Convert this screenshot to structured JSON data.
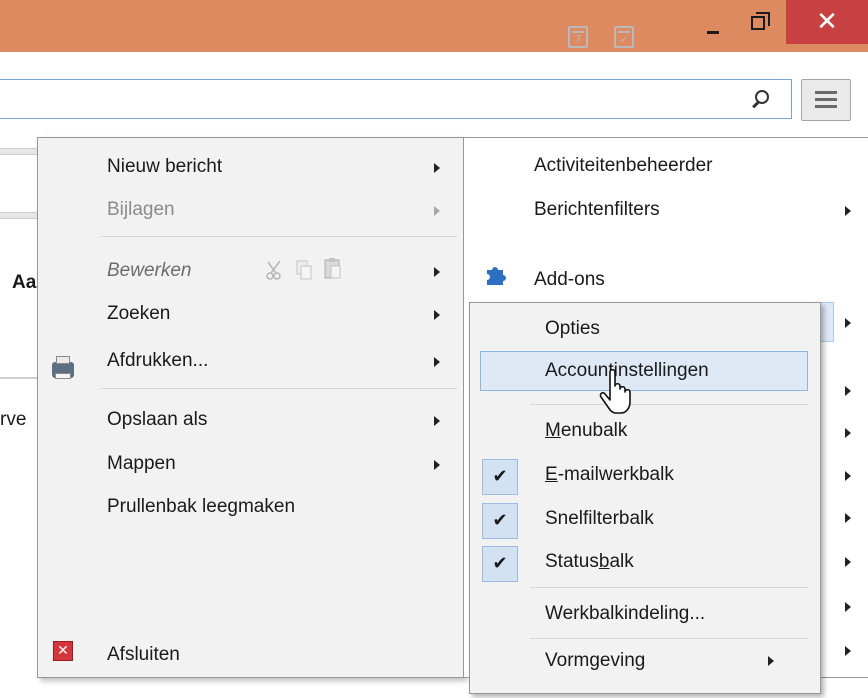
{
  "window": {
    "calendar_day": "7",
    "close_symbol": "✕"
  },
  "background_fragments": {
    "column_header": "Aa",
    "row_text": "rve"
  },
  "main_menu": {
    "items": [
      {
        "label": "Nieuw bericht",
        "has_submenu": true,
        "disabled": false
      },
      {
        "label": "Bijlagen",
        "has_submenu": true,
        "disabled": true
      },
      {
        "label": "Bewerken",
        "has_submenu": true,
        "disabled": false,
        "style": "italic"
      },
      {
        "label": "Zoeken",
        "has_submenu": true,
        "disabled": false
      },
      {
        "label": "Afdrukken...",
        "has_submenu": true,
        "disabled": false
      },
      {
        "label": "Opslaan als",
        "has_submenu": true,
        "disabled": false
      },
      {
        "label": "Mappen",
        "has_submenu": true,
        "disabled": false
      },
      {
        "label": "Prullenbak leegmaken",
        "has_submenu": false,
        "disabled": false
      },
      {
        "label": "Afsluiten",
        "has_submenu": false,
        "disabled": false
      }
    ],
    "right_items": [
      {
        "label": "Activiteitenbeheerder",
        "has_submenu": false
      },
      {
        "label": "Berichtenfilters",
        "has_submenu": true
      },
      {
        "label": "Add-ons",
        "has_submenu": false
      }
    ]
  },
  "submenu": {
    "items": [
      {
        "label_pre": "Opties",
        "label_u": "",
        "label_post": "",
        "checked": false
      },
      {
        "label_pre": "Accountinstellingen",
        "label_u": "",
        "label_post": "",
        "checked": false,
        "highlighted": true
      },
      {
        "label_pre": "",
        "label_u": "M",
        "label_post": "enubalk",
        "checked": false
      },
      {
        "label_pre": "",
        "label_u": "E",
        "label_post": "-mailwerkbalk",
        "checked": true
      },
      {
        "label_pre": "Snelfilterbalk",
        "label_u": "",
        "label_post": "",
        "checked": true
      },
      {
        "label_pre": "Status",
        "label_u": "b",
        "label_post": "alk",
        "checked": true
      },
      {
        "label_pre": "Werkbalkindeling...",
        "label_u": "",
        "label_post": "",
        "checked": false
      },
      {
        "label_pre": "Vormgeving",
        "label_u": "",
        "label_post": "",
        "checked": false,
        "has_submenu": true
      }
    ],
    "check_symbol": "✔"
  },
  "colors": {
    "titlebar": "#de8a60",
    "close_button": "#c84142",
    "menu_bg": "#f2f2f2",
    "highlight": "#dfe9f6"
  }
}
